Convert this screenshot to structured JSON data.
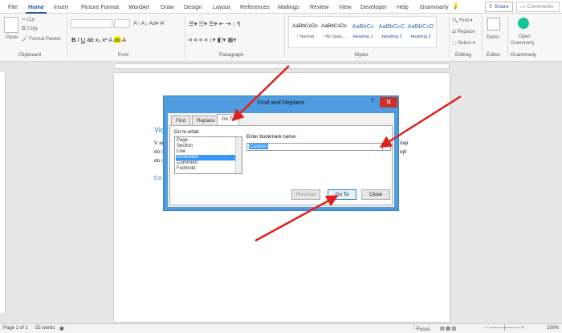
{
  "ribbon_tabs": [
    "File",
    "Home",
    "Insert",
    "Picture Format",
    "WordArt",
    "Draw",
    "Design",
    "Layout",
    "References",
    "Mailings",
    "Review",
    "View",
    "Developer",
    "Help",
    "Grammarly"
  ],
  "share_label": "Share",
  "comments_label": "Comments",
  "clipboard": {
    "paste": "Paste",
    "cut": "Cut",
    "copy": "Copy",
    "format_painter": "Format Painter",
    "group": "Clipboard"
  },
  "font_group": "Font",
  "paragraph_group": "Paragraph",
  "styles": {
    "items": [
      {
        "preview": "AaBbCcDc",
        "name": "↑ Normal"
      },
      {
        "preview": "AaBbCcDc",
        "name": "↑ No Spac..."
      },
      {
        "preview": "AaBbCc",
        "name": "Heading 1"
      },
      {
        "preview": "AaBbCcC",
        "name": "Heading 2"
      },
      {
        "preview": "AaBbCcD",
        "name": "Heading 3"
      }
    ],
    "group": "Styles"
  },
  "editing": {
    "find": "Find",
    "replace": "Replace",
    "select": "Select",
    "group": "Editing"
  },
  "editor": {
    "label": "Editor",
    "group": "Editor"
  },
  "grammarly": {
    "label1": "Open",
    "label2": "Grammarly",
    "group": "Grammarly"
  },
  "document": {
    "heading_fragment": "Vic",
    "line1_start": "V ag",
    "line1_end": "daji",
    "line2_start": "do c",
    "line2_end": "ejit",
    "line3_start": "do u",
    "line4_fragment": "Co"
  },
  "dialog": {
    "title": "Find and Replace",
    "help": "?",
    "close": "✕",
    "tabs": [
      "Find",
      "Replace",
      "Go To"
    ],
    "goto_label": "Go to what:",
    "goto_items": [
      "Page",
      "Section",
      "Line",
      "Bookmark",
      "Comment",
      "Footnote"
    ],
    "selected_item": "Bookmark",
    "enter_label": "Enter bookmark name:",
    "bookmark_value": "Custom",
    "buttons": {
      "previous": "Previous",
      "goto": "Go To",
      "close": "Close"
    }
  },
  "statusbar": {
    "page": "Page 1 of 1",
    "words": "52 words",
    "focus": "Focus",
    "zoom": "100%"
  }
}
